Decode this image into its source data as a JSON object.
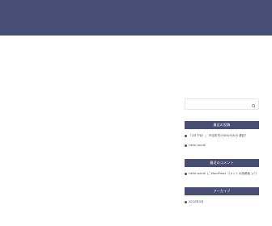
{
  "colors": {
    "header": "#484e73",
    "widget_title_bg": "#484e73",
    "accent": "#484e73"
  },
  "search": {
    "placeholder": "",
    "button_icon": "search-icon"
  },
  "recent_posts": {
    "title": "最近の投稿",
    "items": [
      "「2月下旬！」 市区町村のSNSが大分 遅延？",
      "Hello world!"
    ]
  },
  "recent_comments": {
    "title": "最近のコメント",
    "items": [
      "Hello world! に WordPress コメントの投稿者 より"
    ]
  },
  "archives": {
    "title": "アーカイブ",
    "items": [
      "2020年3月"
    ]
  }
}
